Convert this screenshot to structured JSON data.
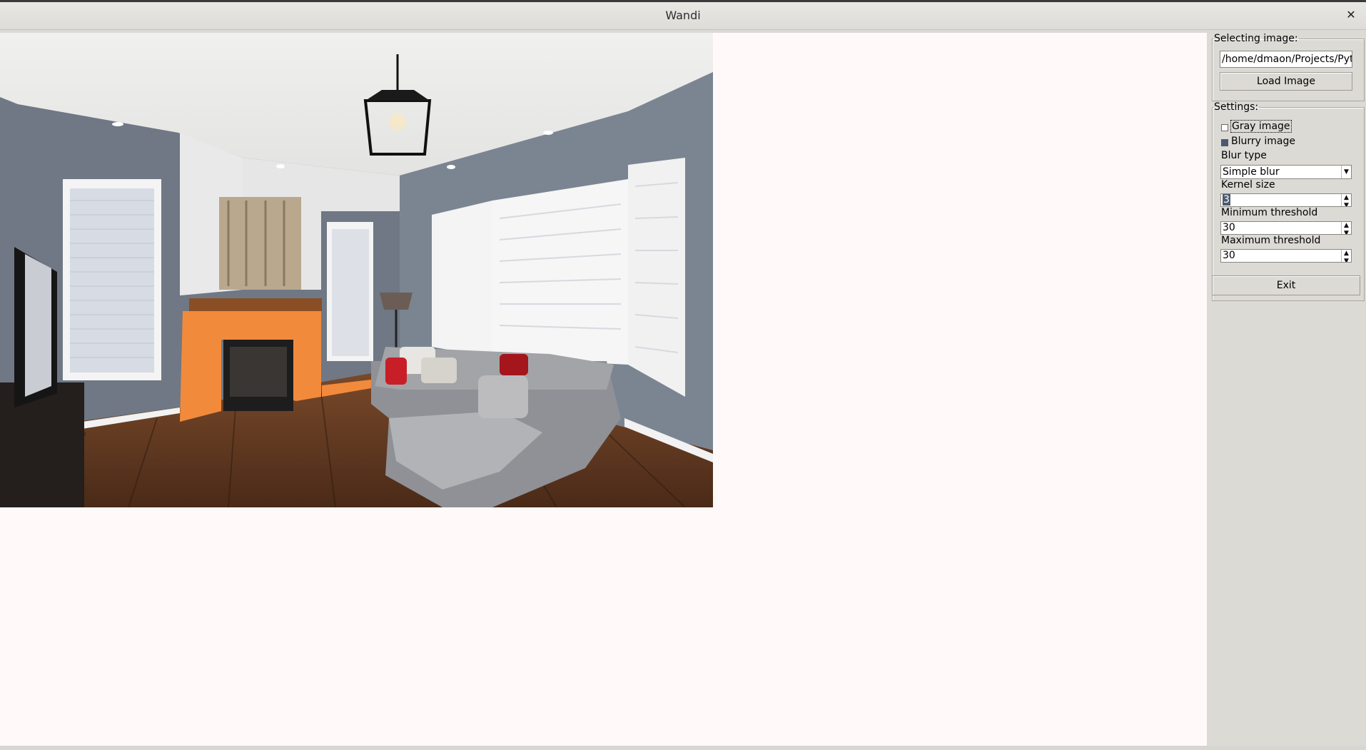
{
  "window": {
    "title": "Wandi",
    "close_glyph": "✕"
  },
  "image_source": {
    "legend": "Selecting image:",
    "path_value": "/home/dmaon/Projects/Pytho",
    "load_button": "Load Image"
  },
  "settings": {
    "legend": "Settings:",
    "gray_label": "Gray image",
    "gray_checked": false,
    "blurry_label": "Blurry image",
    "blurry_checked": true,
    "blur_type_label": "Blur type",
    "blur_type_value": "Simple blur",
    "kernel_label": "Kernel size",
    "kernel_value": "3",
    "min_label": "Minimum threshold",
    "min_value": "30",
    "max_label": "Maximum threshold",
    "max_value": "30"
  },
  "exit_button": "Exit",
  "colors": {
    "canvas_bg": "#fffaf9",
    "panel_bg": "#dcdad5",
    "highlight_orange": "#f28a3c",
    "selection_blue": "#4a5b70"
  }
}
